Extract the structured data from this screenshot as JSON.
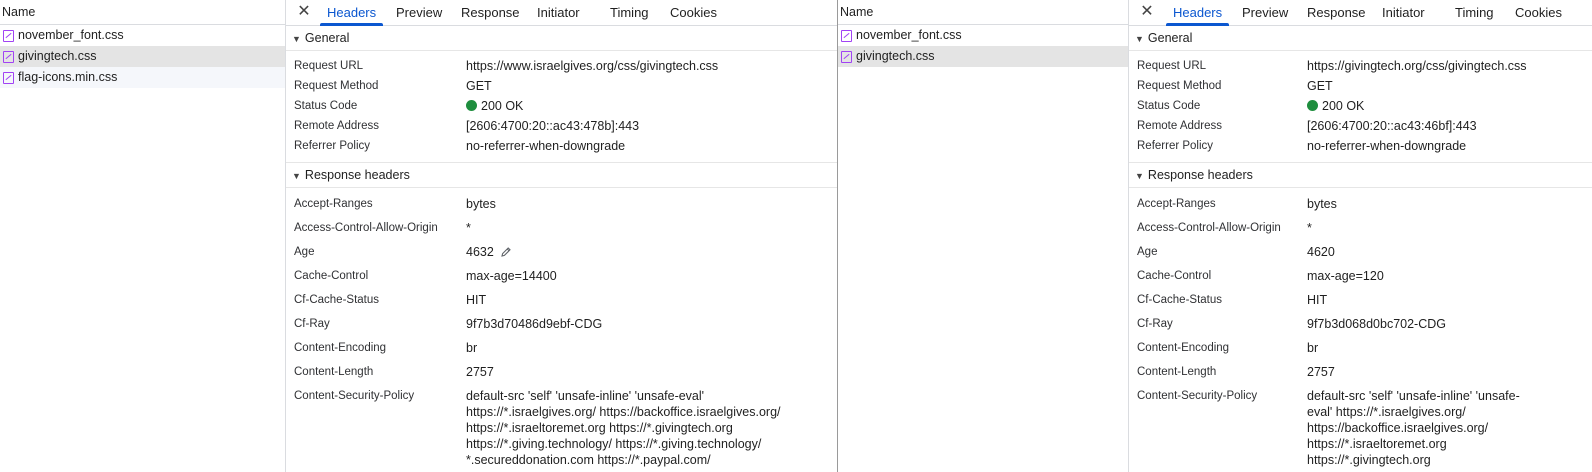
{
  "colors": {
    "accent": "#0b57d0",
    "status_ok": "#1e8e3e",
    "css_icon": "#a142f4"
  },
  "tabs": [
    "Headers",
    "Preview",
    "Response",
    "Initiator",
    "Timing",
    "Cookies"
  ],
  "left": {
    "list_header": "Name",
    "files": [
      "november_font.css",
      "givingtech.css",
      "flag-icons.min.css"
    ],
    "general_title": "General",
    "response_title": "Response headers",
    "general": [
      {
        "name": "Request URL",
        "value": "https://www.israelgives.org/css/givingtech.css"
      },
      {
        "name": "Request Method",
        "value": "GET"
      },
      {
        "name": "Status Code",
        "value": "200 OK"
      },
      {
        "name": "Remote Address",
        "value": "[2606:4700:20::ac43:478b]:443"
      },
      {
        "name": "Referrer Policy",
        "value": "no-referrer-when-downgrade"
      }
    ],
    "response": [
      {
        "name": "Accept-Ranges",
        "value": "bytes"
      },
      {
        "name": "Access-Control-Allow-Origin",
        "value": "*"
      },
      {
        "name": "Age",
        "value": "4632"
      },
      {
        "name": "Cache-Control",
        "value": "max-age=14400"
      },
      {
        "name": "Cf-Cache-Status",
        "value": "HIT"
      },
      {
        "name": "Cf-Ray",
        "value": "9f7b3d70486d9ebf-CDG"
      },
      {
        "name": "Content-Encoding",
        "value": "br"
      },
      {
        "name": "Content-Length",
        "value": "2757"
      },
      {
        "name": "Content-Security-Policy",
        "value": "default-src 'self' 'unsafe-inline' 'unsafe-eval' https://*.israelgives.org/ https://backoffice.israelgives.org/ https://*.israeltoremet.org https://*.givingtech.org https://*.giving.technology/ https://*.giving.technology/ *.secureddonation.com https://*.paypal.com/"
      }
    ]
  },
  "right": {
    "list_header": "Name",
    "files": [
      "november_font.css",
      "givingtech.css"
    ],
    "general_title": "General",
    "response_title": "Response headers",
    "general": [
      {
        "name": "Request URL",
        "value": "https://givingtech.org/css/givingtech.css"
      },
      {
        "name": "Request Method",
        "value": "GET"
      },
      {
        "name": "Status Code",
        "value": "200 OK"
      },
      {
        "name": "Remote Address",
        "value": "[2606:4700:20::ac43:46bf]:443"
      },
      {
        "name": "Referrer Policy",
        "value": "no-referrer-when-downgrade"
      }
    ],
    "response": [
      {
        "name": "Accept-Ranges",
        "value": "bytes"
      },
      {
        "name": "Access-Control-Allow-Origin",
        "value": "*"
      },
      {
        "name": "Age",
        "value": "4620"
      },
      {
        "name": "Cache-Control",
        "value": "max-age=120"
      },
      {
        "name": "Cf-Cache-Status",
        "value": "HIT"
      },
      {
        "name": "Cf-Ray",
        "value": "9f7b3d068d0bc702-CDG"
      },
      {
        "name": "Content-Encoding",
        "value": "br"
      },
      {
        "name": "Content-Length",
        "value": "2757"
      },
      {
        "name": "Content-Security-Policy",
        "value": "default-src 'self' 'unsafe-inline' 'unsafe-eval' https://*.israelgives.org/ https://backoffice.israelgives.org/ https://*.israeltoremet.org https://*.givingtech.org"
      }
    ]
  }
}
